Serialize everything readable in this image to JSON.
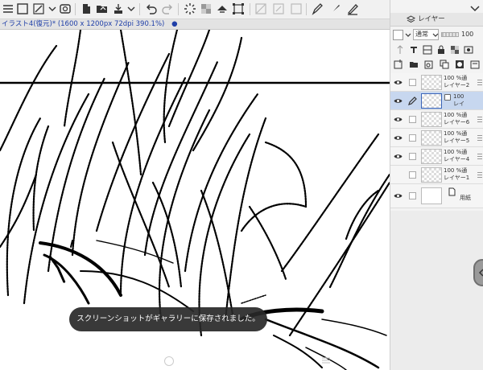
{
  "document": {
    "tab_title": "イラスト4(復元)* (1600 x 1200px 72dpi 390.1%)",
    "tab_close": "●"
  },
  "toolbar": {
    "icons": [
      "menu-icon",
      "select-all-icon",
      "transform-icon",
      "dropdown-icon",
      "new-layer-icon",
      "open-folder-icon",
      "save-icon",
      "print-icon",
      "undo-icon",
      "redo-icon",
      "loading-icon",
      "fill-icon",
      "rotate-icon",
      "resize-icon",
      "crop-icon",
      "clear-icon",
      "deselect-icon",
      "pen-icon",
      "brush-icon",
      "eraser-icon"
    ]
  },
  "panel": {
    "tab_label": "レイヤー",
    "blend_mode": "通常",
    "opacity_value": "100",
    "colors": {
      "accent": "#1f3fa8",
      "selected_row": "#c7d7ef"
    }
  },
  "layers": [
    {
      "opacity": "100 %通",
      "name": "レイヤー2",
      "visible": true,
      "selected": false
    },
    {
      "opacity": "100",
      "name": "レイ",
      "visible": true,
      "selected": true
    },
    {
      "opacity": "100 %通",
      "name": "レイヤー6",
      "visible": true,
      "selected": false
    },
    {
      "opacity": "100 %通",
      "name": "レイヤー5",
      "visible": true,
      "selected": false
    },
    {
      "opacity": "100 %通",
      "name": "レイヤー4",
      "visible": true,
      "selected": false
    },
    {
      "opacity": "100 %通",
      "name": "レイヤー1",
      "visible": false,
      "selected": false
    },
    {
      "opacity": "",
      "name": "用紙",
      "visible": true,
      "selected": false,
      "paper": true
    }
  ],
  "toast": {
    "message": "スクリーンショットがギャラリーに保存されました。"
  }
}
